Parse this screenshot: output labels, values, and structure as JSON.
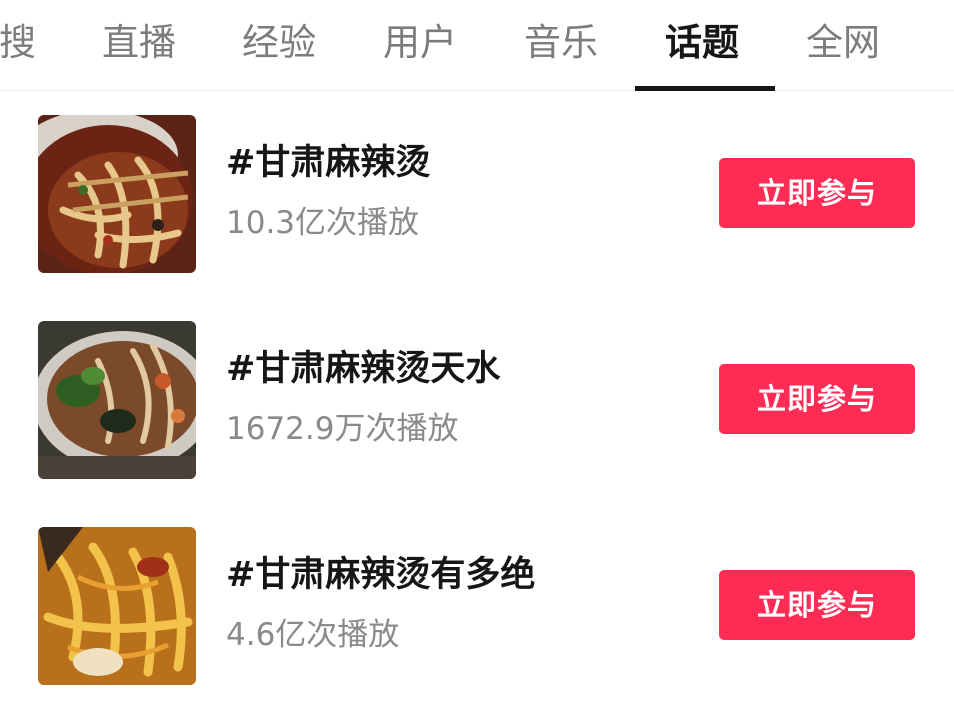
{
  "tabs": [
    {
      "label": "搜",
      "active": false
    },
    {
      "label": "直播",
      "active": false
    },
    {
      "label": "经验",
      "active": false
    },
    {
      "label": "用户",
      "active": false
    },
    {
      "label": "音乐",
      "active": false
    },
    {
      "label": "话题",
      "active": true
    },
    {
      "label": "全网",
      "active": false
    }
  ],
  "topics": [
    {
      "title": "#甘肃麻辣烫",
      "views": "10.3亿次播放",
      "button": "立即参与"
    },
    {
      "title": "#甘肃麻辣烫天水",
      "views": "1672.9万次播放",
      "button": "立即参与"
    },
    {
      "title": "#甘肃麻辣烫有多绝",
      "views": "4.6亿次播放",
      "button": "立即参与"
    }
  ],
  "colors": {
    "accent": "#fe2c55",
    "active_tab": "#161616",
    "inactive_tab": "#7c7c7c",
    "secondary_text": "#8a8a8a"
  }
}
